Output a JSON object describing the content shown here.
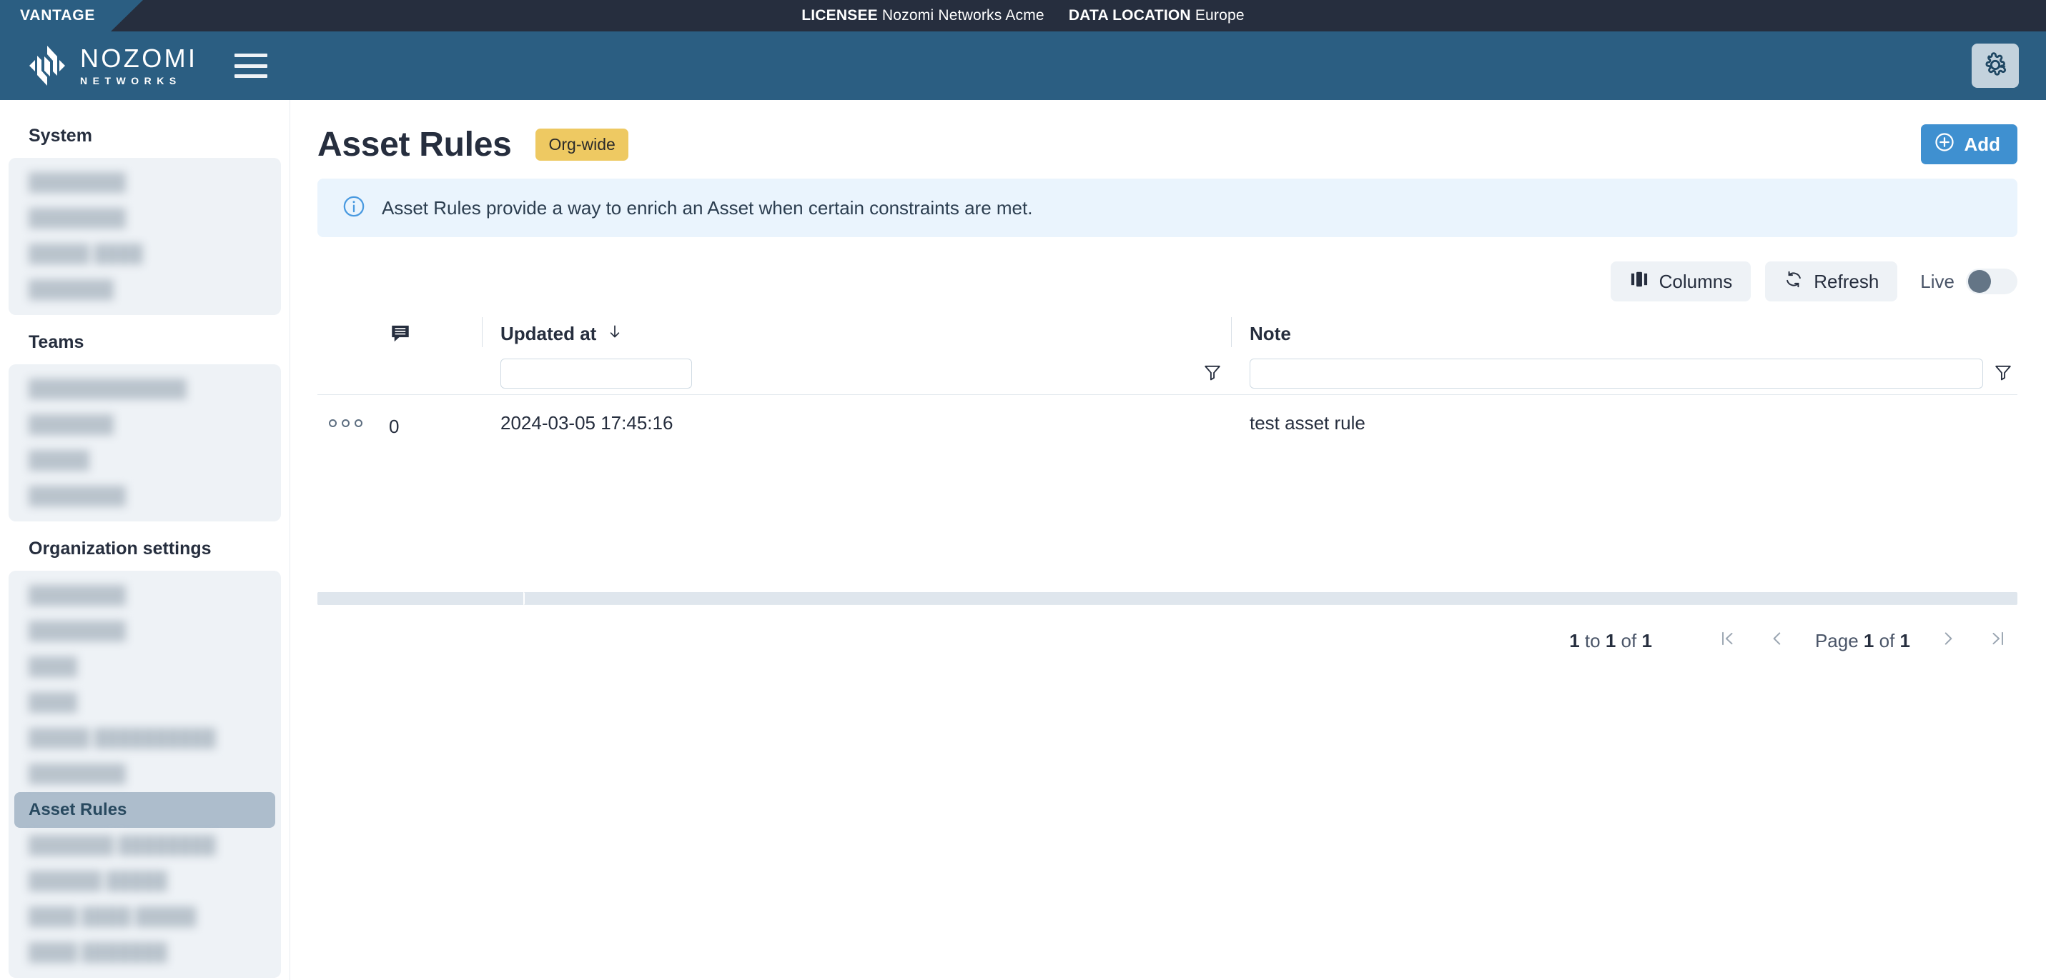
{
  "topbar": {
    "product_tab": "VANTAGE",
    "licensee_label": "LICENSEE",
    "licensee_value": "Nozomi Networks Acme",
    "data_location_label": "DATA LOCATION",
    "data_location_value": "Europe"
  },
  "header": {
    "brand_line1": "NOZOMI",
    "brand_line2": "NETWORKS",
    "menu_icon": "hamburger-icon",
    "settings_icon": "gear-icon"
  },
  "sidebar": {
    "groups": [
      {
        "title": "System",
        "items": [
          {
            "label": "████████",
            "redacted": true
          },
          {
            "label": "████████",
            "redacted": true
          },
          {
            "label": "█████  ████",
            "redacted": true
          },
          {
            "label": "███████",
            "redacted": true
          }
        ]
      },
      {
        "title": "Teams",
        "items": [
          {
            "label": "█████████████",
            "redacted": true
          },
          {
            "label": "███████",
            "redacted": true
          },
          {
            "label": "█████",
            "redacted": true
          },
          {
            "label": "████████",
            "redacted": true
          }
        ]
      },
      {
        "title": "Organization settings",
        "items": [
          {
            "label": "████████",
            "redacted": true
          },
          {
            "label": "████████",
            "redacted": true
          },
          {
            "label": "████",
            "redacted": true
          },
          {
            "label": "████",
            "redacted": true
          },
          {
            "label": "█████ ██████████",
            "redacted": true
          },
          {
            "label": "████████",
            "redacted": true
          },
          {
            "label": "Asset Rules",
            "redacted": false,
            "active": true
          },
          {
            "label": "███████ ████████",
            "redacted": true
          },
          {
            "label": "██████ █████",
            "redacted": true
          },
          {
            "label": "████ ████ █████",
            "redacted": true
          },
          {
            "label": "████ ███████",
            "redacted": true
          }
        ]
      }
    ]
  },
  "page": {
    "title": "Asset Rules",
    "scope_badge": "Org-wide",
    "add_button": "Add",
    "add_icon": "plus-circle-icon",
    "info_banner": "Asset Rules provide a way to enrich an Asset when certain constraints are met.",
    "info_icon": "info-circle-icon"
  },
  "toolbar": {
    "columns_label": "Columns",
    "columns_icon": "columns-icon",
    "refresh_label": "Refresh",
    "refresh_icon": "refresh-icon",
    "live_label": "Live",
    "live_on": false
  },
  "table": {
    "columns": [
      {
        "key": "menu",
        "label": ""
      },
      {
        "key": "notes_count",
        "label": "",
        "icon": "comment-icon"
      },
      {
        "key": "updated_at",
        "label": "Updated at",
        "sort": "desc",
        "sort_icon": "arrow-down-icon",
        "filter_value": "",
        "filter_icon": "funnel-icon"
      },
      {
        "key": "note",
        "label": "Note",
        "filter_value": "",
        "filter_icon": "funnel-icon"
      }
    ],
    "rows": [
      {
        "menu_icon": "row-actions-icon",
        "notes_count": "0",
        "updated_at": "2024-03-05 17:45:16",
        "note": "test asset rule"
      }
    ]
  },
  "pagination": {
    "range_prefix": "1",
    "range_middle": "to",
    "range_to": "1",
    "range_of": "of",
    "range_total": "1",
    "first_icon": "first-page-icon",
    "prev_icon": "prev-page-icon",
    "page_word": "Page",
    "page_current": "1",
    "page_of": "of",
    "page_total": "1",
    "next_icon": "next-page-icon",
    "last_icon": "last-page-icon"
  }
}
